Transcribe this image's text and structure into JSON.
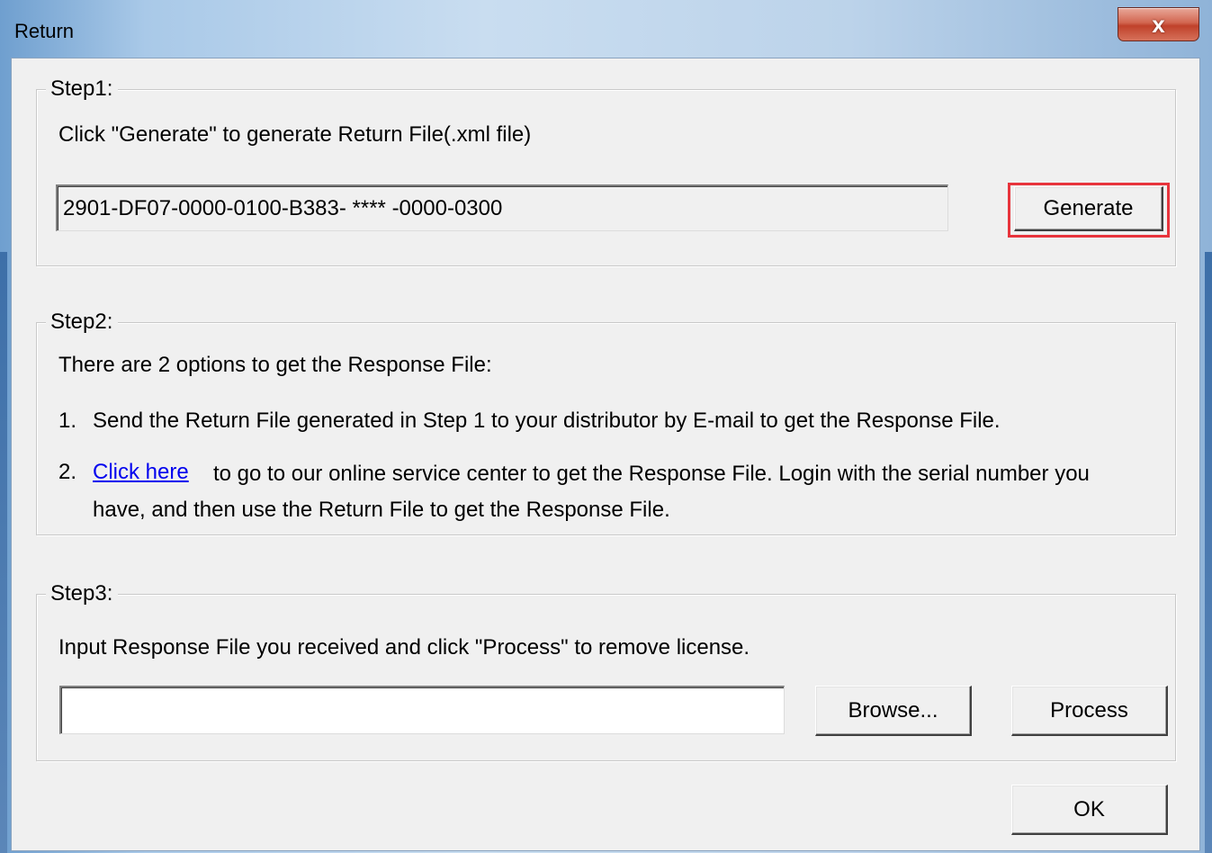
{
  "window": {
    "title": "Return",
    "close_glyph": "x"
  },
  "step1": {
    "legend": "Step1:",
    "instruction": "Click \"Generate\" to generate Return File(.xml file)",
    "return_code": "2901-DF07-0000-0100-B383- **** -0000-0300",
    "generate_label": "Generate",
    "highlight_color": "#e8343c"
  },
  "step2": {
    "legend": "Step2:",
    "intro": "There are 2 options to get the Response File:",
    "option1_number": "1.",
    "option1_text": "Send the Return File generated in Step 1 to your distributor by E-mail to get the Response File.",
    "option2_number": "2.",
    "option2_link": "Click here",
    "option2_text_line1": "to go to our online service center to get the Response File. Login with the serial number you",
    "option2_text_line2": "have, and then use the Return File to get the Response File."
  },
  "step3": {
    "legend": "Step3:",
    "instruction": "Input Response File you received and click \"Process\" to remove license.",
    "response_file_value": "",
    "browse_label": "Browse...",
    "process_label": "Process"
  },
  "footer": {
    "ok_label": "OK"
  }
}
